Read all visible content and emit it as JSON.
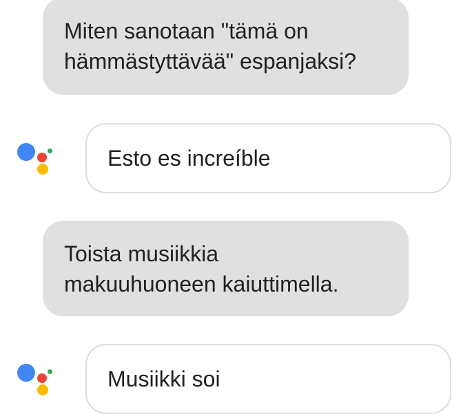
{
  "conversation": {
    "messages": [
      {
        "role": "user",
        "lines": [
          "Miten sanotaan \"tämä on",
          "hämmästyttävää\" espanjaksi?"
        ]
      },
      {
        "role": "assistant",
        "text": "Esto es increíble"
      },
      {
        "role": "user",
        "lines": [
          "Toista musiikkia",
          "makuuhuoneen kaiuttimella."
        ]
      },
      {
        "role": "assistant",
        "text": "Musiikki soi"
      }
    ]
  },
  "assistant_logo": {
    "icon": "google-assistant-icon",
    "colors": {
      "blue": "#4285f4",
      "red": "#ea4335",
      "yellow": "#fbbc04",
      "green": "#34a853"
    }
  },
  "colors": {
    "user_bubble_bg": "#e0e0e0",
    "assistant_bubble_border": "#dadce0",
    "text": "#202124"
  }
}
